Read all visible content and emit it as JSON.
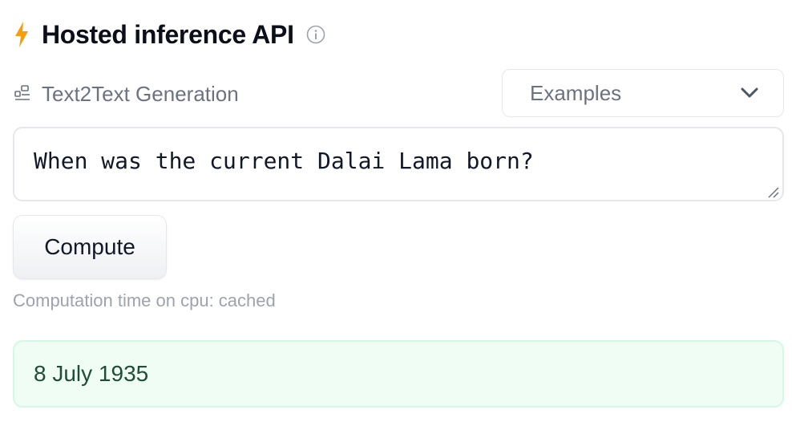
{
  "header": {
    "title": "Hosted inference API",
    "bolt_icon": "lightning-bolt-icon",
    "info_icon": "info-circle-icon",
    "accent_color": "#f59e0b"
  },
  "task": {
    "icon": "text2text-task-icon",
    "label": "Text2Text Generation"
  },
  "examples_dropdown": {
    "label": "Examples",
    "icon": "chevron-down-icon"
  },
  "input": {
    "value": "When was the current Dalai Lama born?"
  },
  "compute_button": {
    "label": "Compute"
  },
  "computation_time": {
    "text": "Computation time on cpu: cached"
  },
  "output": {
    "text": "8 July 1935",
    "background_color": "#f0fdf4",
    "border_color": "#d1fae5"
  }
}
